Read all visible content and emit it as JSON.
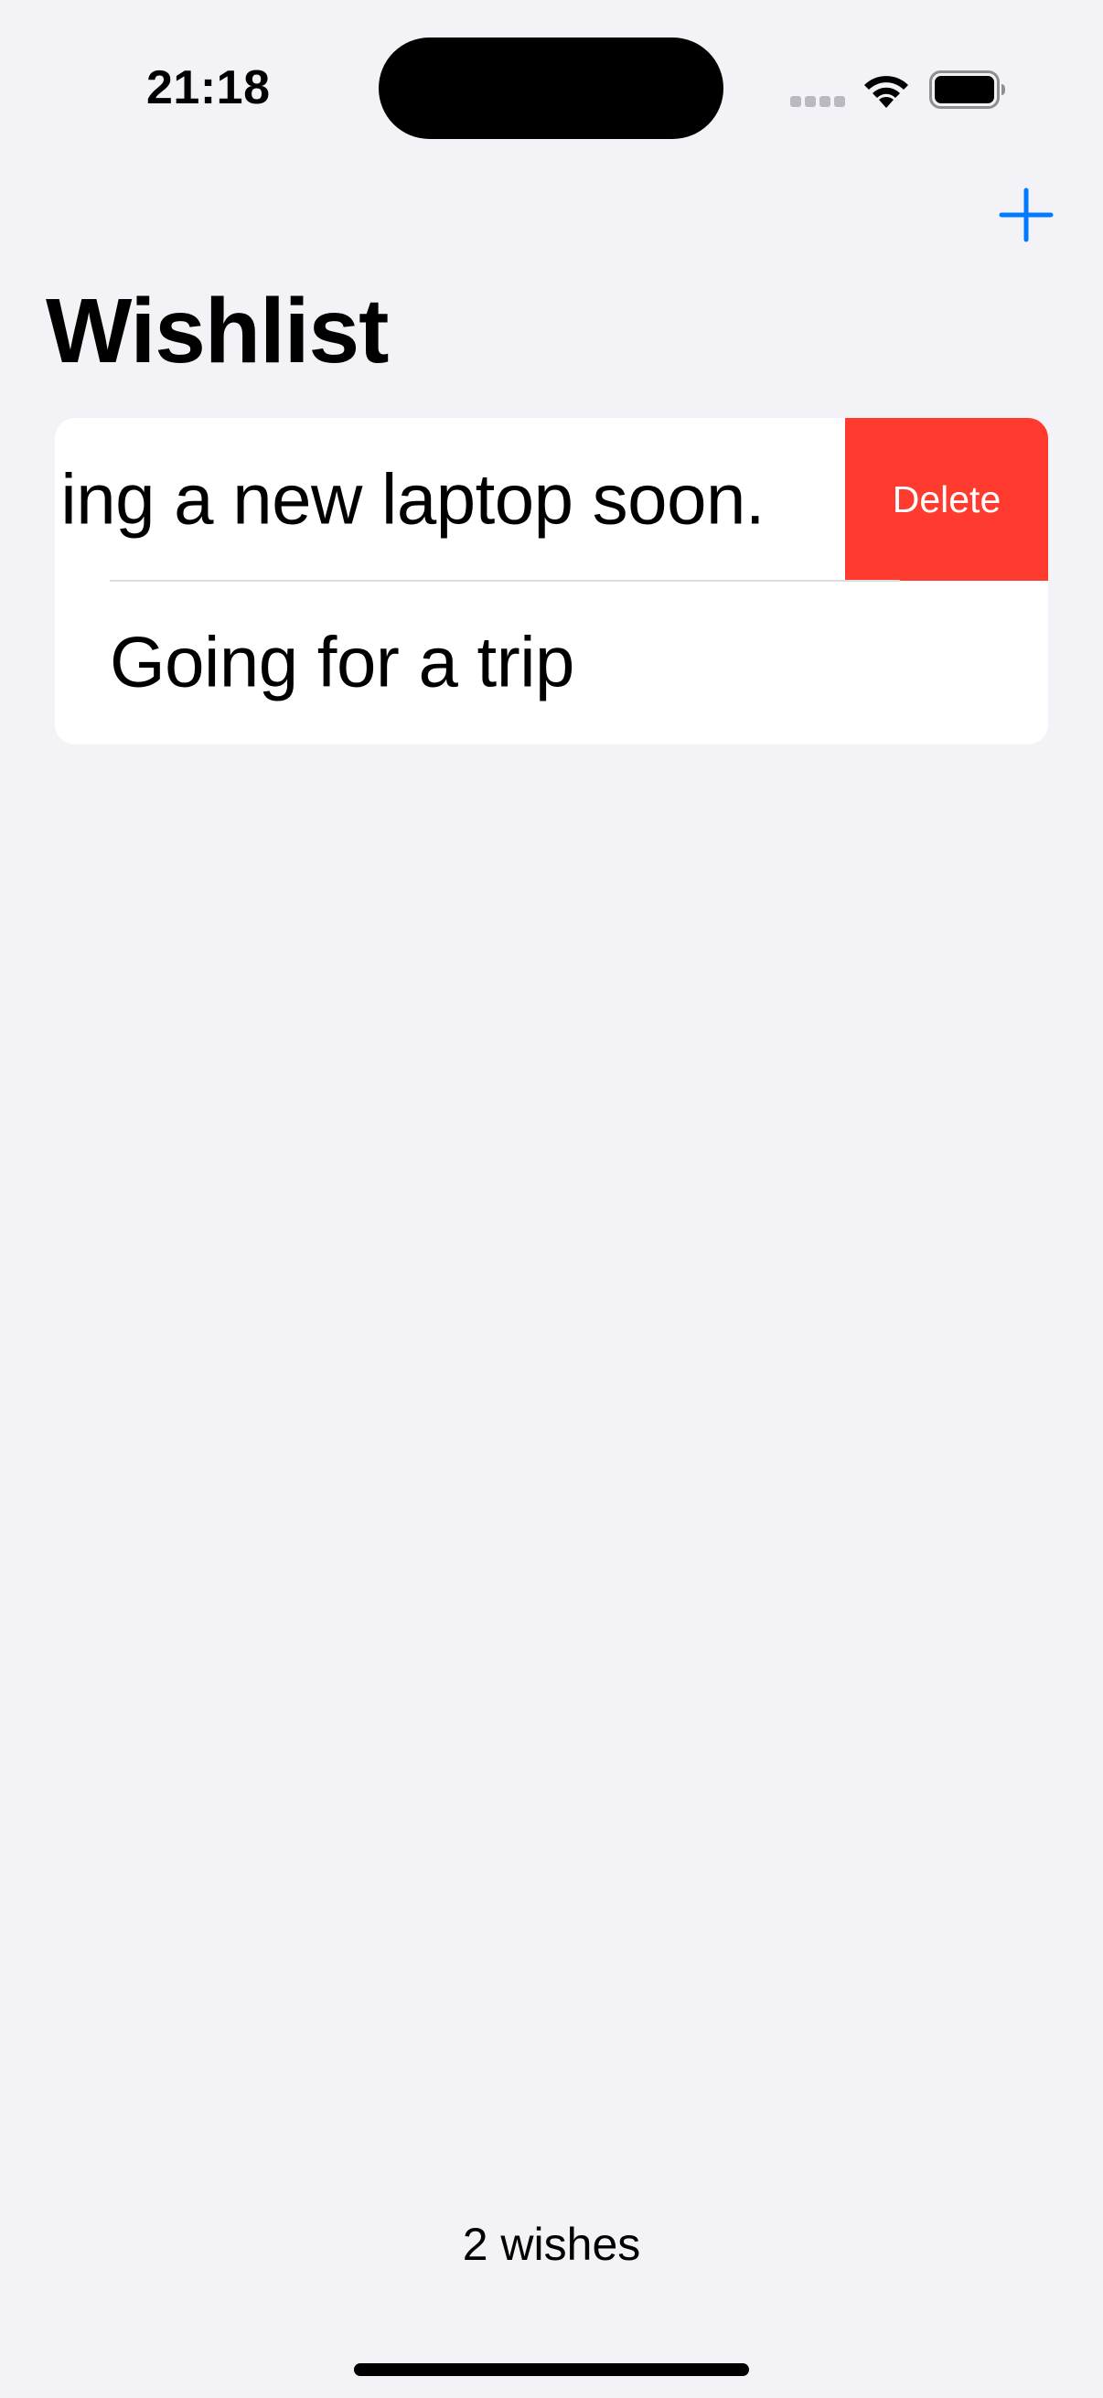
{
  "status_bar": {
    "time": "21:18",
    "icons": [
      "cellular-icon",
      "wifi-icon",
      "battery-icon"
    ]
  },
  "nav": {
    "add_icon": "plus-icon",
    "title": "Wishlist"
  },
  "list": {
    "items": [
      {
        "text": "ing a new laptop soon.",
        "swiped": true
      },
      {
        "text": "Going for a trip",
        "swiped": false
      }
    ],
    "delete_label": "Delete"
  },
  "footer": {
    "count": "2 wishes"
  },
  "colors": {
    "background": "#f2f2f7",
    "accent": "#007aff",
    "destructive": "#ff3b30",
    "card": "#ffffff"
  }
}
